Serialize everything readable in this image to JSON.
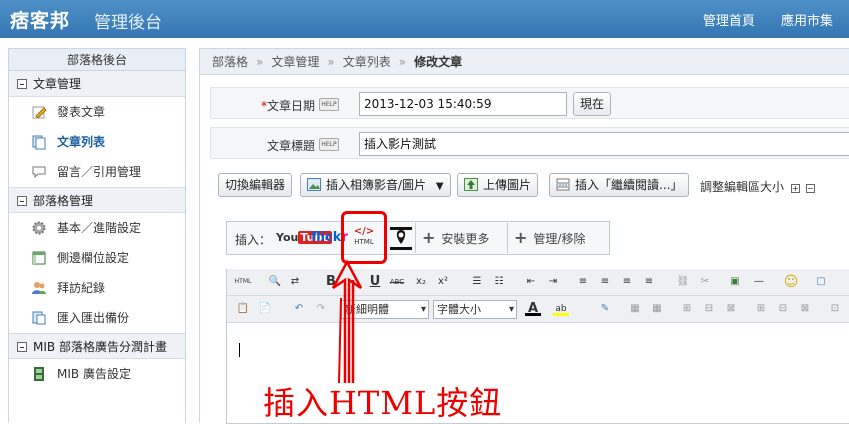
{
  "header": {
    "logo_text": "痞客邦",
    "admin_title": "管理後台",
    "nav": [
      "管理首頁",
      "應用市集"
    ]
  },
  "sidebar": {
    "title": "部落格後台",
    "sections": [
      {
        "label": "文章管理",
        "items": [
          {
            "label": "發表文章",
            "icon": "pencil-icon"
          },
          {
            "label": "文章列表",
            "icon": "pages-icon",
            "active": true
          },
          {
            "label": "留言／引用管理",
            "icon": "comment-icon"
          }
        ]
      },
      {
        "label": "部落格管理",
        "items": [
          {
            "label": "基本／進階設定",
            "icon": "gear-icon"
          },
          {
            "label": "側邊欄位設定",
            "icon": "layout-icon"
          },
          {
            "label": "拜訪紀錄",
            "icon": "users-icon"
          },
          {
            "label": "匯入匯出備份",
            "icon": "import-icon"
          }
        ]
      },
      {
        "label": "MIB 部落格廣告分潤計畫",
        "items": [
          {
            "label": "MIB 廣告設定",
            "icon": "film-icon"
          }
        ]
      }
    ]
  },
  "breadcrumb": [
    "部落格",
    "文章管理",
    "文章列表",
    "修改文章"
  ],
  "form": {
    "date_label": "文章日期",
    "date_required": "*",
    "help": "HELP",
    "date_value": "2013-12-03 15:40:59",
    "now_button": "現在",
    "title_label": "文章標題",
    "title_value": "插入影片測試"
  },
  "toolbar": {
    "switch_editor": "切換編輯器",
    "insert_album": "插入相簿影音/圖片",
    "upload_image": "上傳圖片",
    "insert_more": "插入「繼續閱讀...」",
    "resize_label": "調整編輯區大小"
  },
  "insertbar": {
    "label": "插入：",
    "youtube": "You",
    "youtube2": "Tube",
    "flickr_a": "flick",
    "flickr_b": "r",
    "html_code": "</>",
    "html_text": "HTML",
    "install_more": "安裝更多",
    "manage_remove": "管理/移除"
  },
  "editor": {
    "html_btn": "HTML",
    "font_family": "新細明體",
    "font_size": "字體大小"
  },
  "annotation": "插入HTML按鈕",
  "colors": {
    "accent": "#3a7bbf",
    "annotation": "#e00000"
  }
}
